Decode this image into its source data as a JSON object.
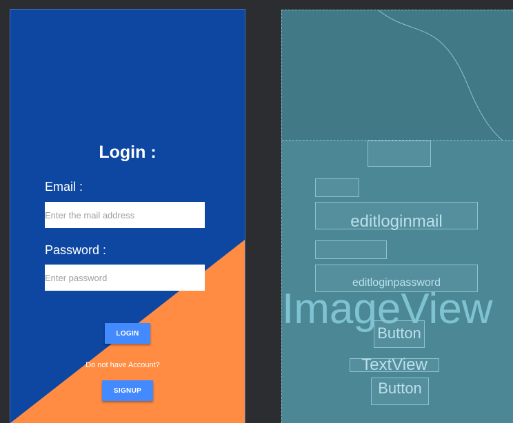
{
  "design": {
    "title": "Login :",
    "email_label": "Email :",
    "email_placeholder": "Enter the mail address",
    "password_label": "Password :",
    "password_placeholder": "Enter password",
    "login_button": "LOGIN",
    "no_account_text": "Do not have Account?",
    "signup_button": "SIGNUP",
    "colors": {
      "background": "#0d47a1",
      "accent_triangle": "#ff8c42",
      "button": "#448aff"
    }
  },
  "blueprint": {
    "image_view_label": "ImageView",
    "email_field_label": "editloginmail",
    "password_field_label": "editloginpassword",
    "login_button_label": "Button",
    "text_view_label": "TextView",
    "signup_button_label": "Button",
    "colors": {
      "background": "#4c8796",
      "outline": "#8cc3cf"
    }
  }
}
